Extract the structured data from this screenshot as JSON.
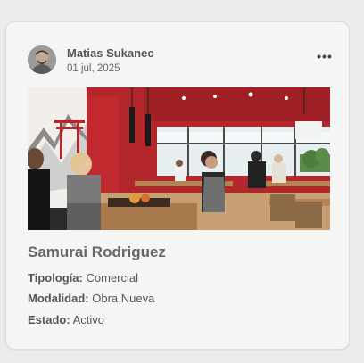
{
  "post": {
    "author": "Matias Sukanec",
    "date": "01 jul, 2025",
    "more_label": "•••",
    "title": "Samurai Rodriguez",
    "details": [
      {
        "label": "Tipología:",
        "value": "Comercial"
      },
      {
        "label": "Modalidad:",
        "value": "Obra Nueva"
      },
      {
        "label": "Estado:",
        "value": "Activo"
      }
    ]
  },
  "colors": {
    "accent_red": "#b3262b",
    "card_background": "#f5f5f5"
  }
}
